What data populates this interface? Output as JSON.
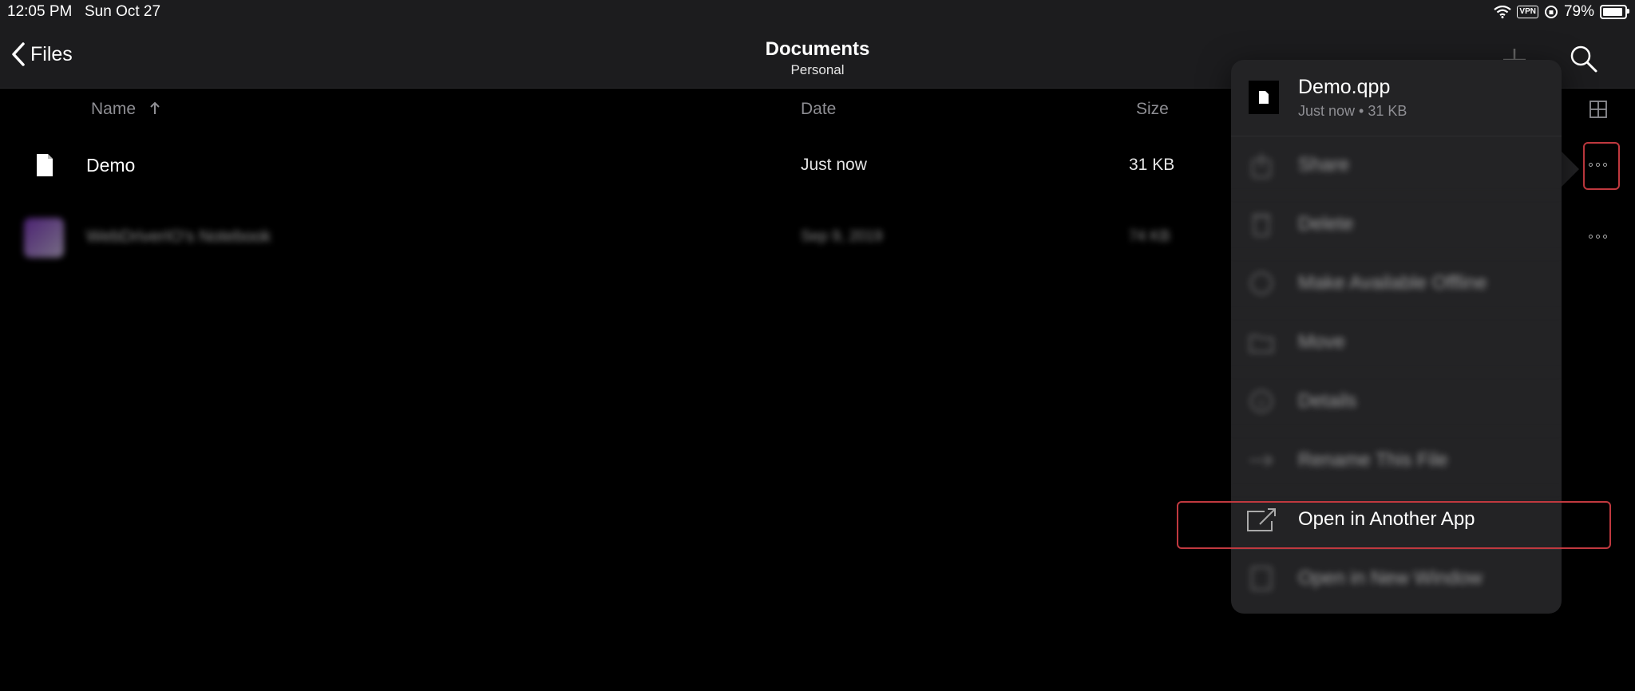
{
  "status": {
    "time": "12:05 PM",
    "date": "Sun Oct 27",
    "vpn": "VPN",
    "battery": "79%"
  },
  "nav": {
    "back_label": "Files",
    "title": "Documents",
    "subtitle": "Personal"
  },
  "columns": {
    "name": "Name",
    "date": "Date",
    "size": "Size"
  },
  "files": [
    {
      "name": "Demo",
      "date": "Just now",
      "size": "31 KB"
    },
    {
      "name": "WebDriverIO's Notebook",
      "date": "Sep 9, 2019",
      "size": "74 KB"
    }
  ],
  "popover": {
    "file_name": "Demo.qpp",
    "file_meta": "Just now • 31 KB",
    "items": [
      {
        "label": "Share",
        "icon": "share-icon",
        "blurred": true
      },
      {
        "label": "Delete",
        "icon": "trash-icon",
        "blurred": true
      },
      {
        "label": "Make Available Offline",
        "icon": "offline-icon",
        "blurred": true
      },
      {
        "label": "Move",
        "icon": "move-icon",
        "blurred": true
      },
      {
        "label": "Details",
        "icon": "info-icon",
        "blurred": true
      },
      {
        "label": "Rename This File",
        "icon": "rename-icon",
        "blurred": true
      },
      {
        "label": "Open in Another App",
        "icon": "open-external-icon",
        "blurred": false
      },
      {
        "label": "Open in New Window",
        "icon": "new-window-icon",
        "blurred": true
      }
    ]
  },
  "colors": {
    "background": "#000000",
    "bar": "#1c1c1e",
    "popover": "#232325",
    "highlight": "#c0393f",
    "secondary_text": "#8e8e93"
  }
}
